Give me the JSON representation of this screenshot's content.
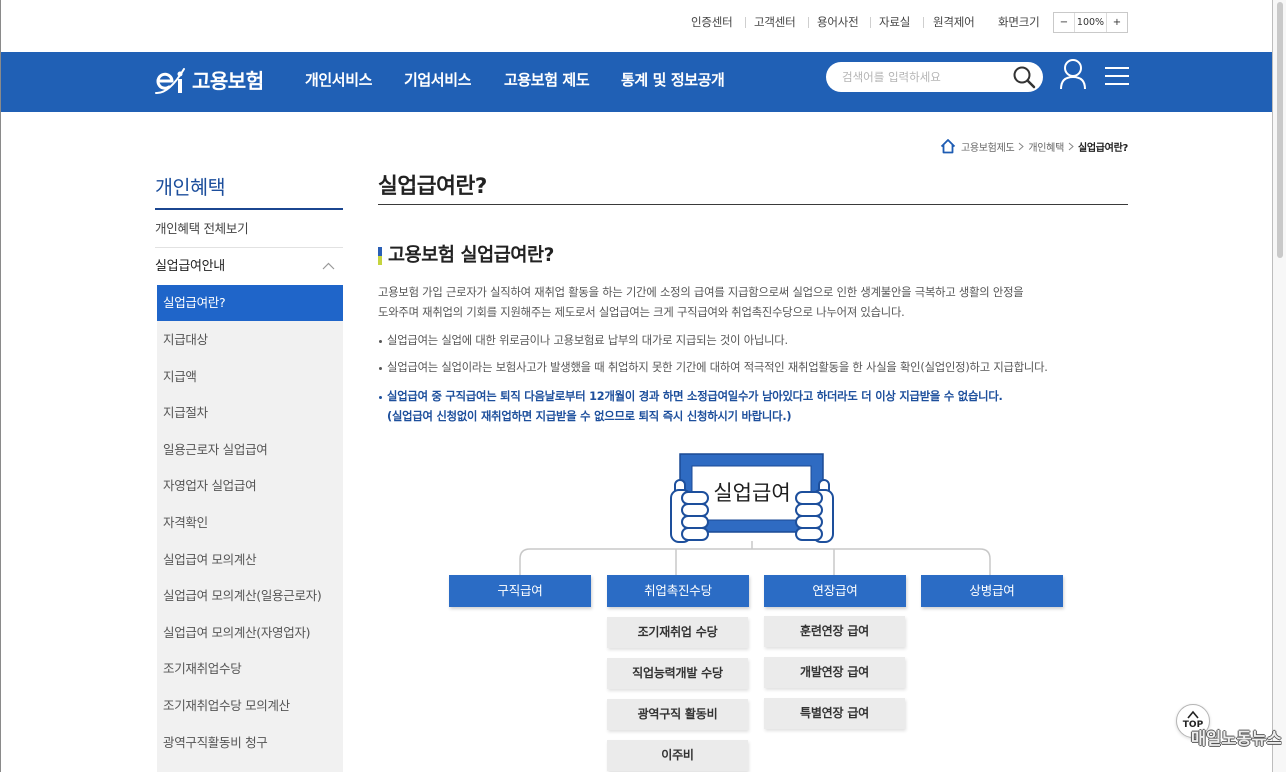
{
  "utility": {
    "links": [
      "인증센터",
      "고객센터",
      "용어사전",
      "자료실",
      "원격제어"
    ],
    "font_size_label": "화면크기",
    "zoom_out": "−",
    "zoom_value": "100%",
    "zoom_in": "+"
  },
  "header": {
    "logo_mark_letters": "ei",
    "logo_text": "고용보험",
    "nav": [
      "개인서비스",
      "기업서비스",
      "고용보험 제도",
      "통계 및 정보공개"
    ],
    "search_placeholder": "검색어를 입력하세요"
  },
  "breadcrumb": [
    "고용보험제도",
    "개인혜택",
    "실업급여란?"
  ],
  "sidebar": {
    "title": "개인혜택",
    "all_link": "개인혜택 전체보기",
    "group": "실업급여안내",
    "active_item": "실업급여란?",
    "items": [
      "지급대상",
      "지급액",
      "지급절차",
      "일용근로자 실업급여",
      "자영업자 실업급여",
      "자격확인",
      "실업급여 모의계산",
      "실업급여 모의계산(일용근로자)",
      "실업급여 모의계산(자영업자)",
      "조기재취업수당",
      "조기재취업수당 모의계산",
      "광역구직활동비 청구"
    ]
  },
  "main": {
    "page_title": "실업급여란?",
    "section_title": "고용보험 실업급여란?",
    "intro_lines": [
      "고용보험 가입 근로자가 실직하여 재취업 활동을 하는 기간에 소정의 급여를 지급함으로써 실업으로 인한 생계불안을 극복하고 생활의 안정을",
      "도와주며 재취업의 기회를 지원해주는 제도로서 실업급여는 크게 구직급여와 취업촉진수당으로 나누어져 있습니다."
    ],
    "bullets": [
      "실업급여는 실업에 대한 위로금이나 고용보험료 납부의 대가로 지급되는 것이 아닙니다.",
      "실업급여는 실업이라는 보험사고가 발생했을 때 취업하지 못한 기간에 대하여 적극적인 재취업활동을 한 사실을 확인(실업인정)하고 지급합니다."
    ],
    "notice_lines": [
      "실업급여 중 구직급여는 퇴직 다음날로부터 12개월이 경과 하면 소정급여일수가 남아있다고 하더라도 더 이상 지급받을 수 없습니다.",
      "(실업급여 신청없이 재취업하면 지급받을 수 없으므로 퇴직 즉시 신청하시기 바랍니다.)"
    ]
  },
  "diagram": {
    "sign_text": "실업급여",
    "categories": [
      "구직급여",
      "취업촉진수당",
      "연장급여",
      "상병급여"
    ],
    "promotion_allowances": [
      "조기재취업 수당",
      "직업능력개발 수당",
      "광역구직 활동비",
      "이주비"
    ],
    "extended_benefits": [
      "훈련연장 급여",
      "개발연장 급여",
      "특별연장 급여"
    ]
  },
  "top_button": "TOP",
  "watermark": "매일노동뉴스",
  "icons": {
    "logo": "logo-mark-icon",
    "search": "search-icon",
    "user": "user-icon",
    "menu": "menu-icon",
    "home": "home-icon",
    "breadcrumb_separator": "chevron-right-icon",
    "group_toggle": "chevron-up-icon",
    "scroll_top": "arrow-up-icon"
  },
  "colors": {
    "header_blue": "#2060b5",
    "active_menu_blue": "#1f65c9",
    "benefit_box_blue": "#2b6cc5",
    "notice_blue": "#1d4f9c",
    "sub_box_grey": "#ebebeb",
    "sidebar_list_bg": "#f1f1f1",
    "section_marker_blue": "#2a5fb5",
    "section_marker_yellow": "#c5d43f"
  }
}
